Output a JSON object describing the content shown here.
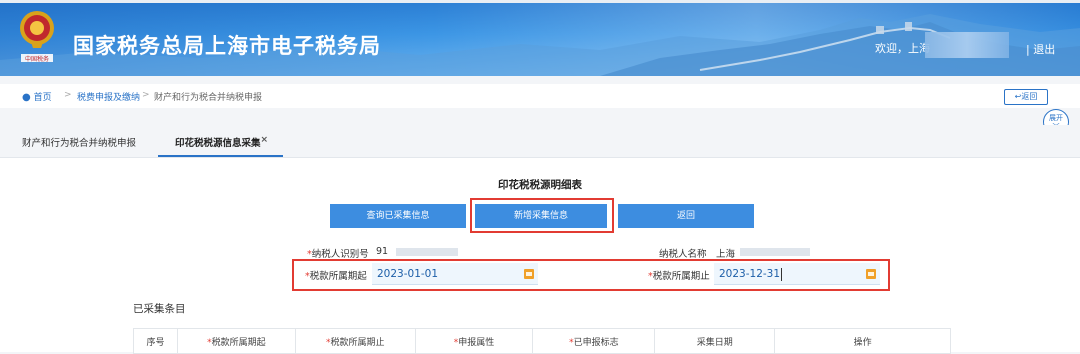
{
  "header": {
    "site_title": "国家税务总局上海市电子税务局",
    "welcome": "欢迎，上海",
    "logout": "| 退出",
    "emblem_caption": "中国税务"
  },
  "breadcrumb": {
    "home": "首页",
    "sep": ">",
    "level1": "税费申报及缴纳",
    "level2": "财产和行为税合并纳税申报"
  },
  "back_button": "返回",
  "expand_button": "展开",
  "tabs": [
    {
      "label": "财产和行为税合并纳税申报"
    },
    {
      "label": "印花税税源信息采集",
      "close": "×"
    }
  ],
  "form": {
    "title": "印花税税源明细表",
    "buttons": {
      "query": "查询已采集信息",
      "add": "新增采集信息",
      "back": "返回"
    },
    "taxpayer_id_label": "纳税人识别号",
    "taxpayer_id_value": "91",
    "taxpayer_name_label": "纳税人名称",
    "taxpayer_name_value": "上海",
    "period_start_label": "税款所属期起",
    "period_start_value": "2023-01-01",
    "period_end_label": "税款所属期止",
    "period_end_value": "2023-12-31",
    "required_mark": "*"
  },
  "collected": {
    "section_title": "已采集条目",
    "columns": [
      "序号",
      "*税款所属期起",
      "*税款所属期止",
      "*申报属性",
      "*已申报标志",
      "采集日期",
      "操作"
    ]
  },
  "colors": {
    "brand_blue": "#3d8de0",
    "highlight_red": "#e23b32",
    "link_blue": "#2a73c7"
  }
}
